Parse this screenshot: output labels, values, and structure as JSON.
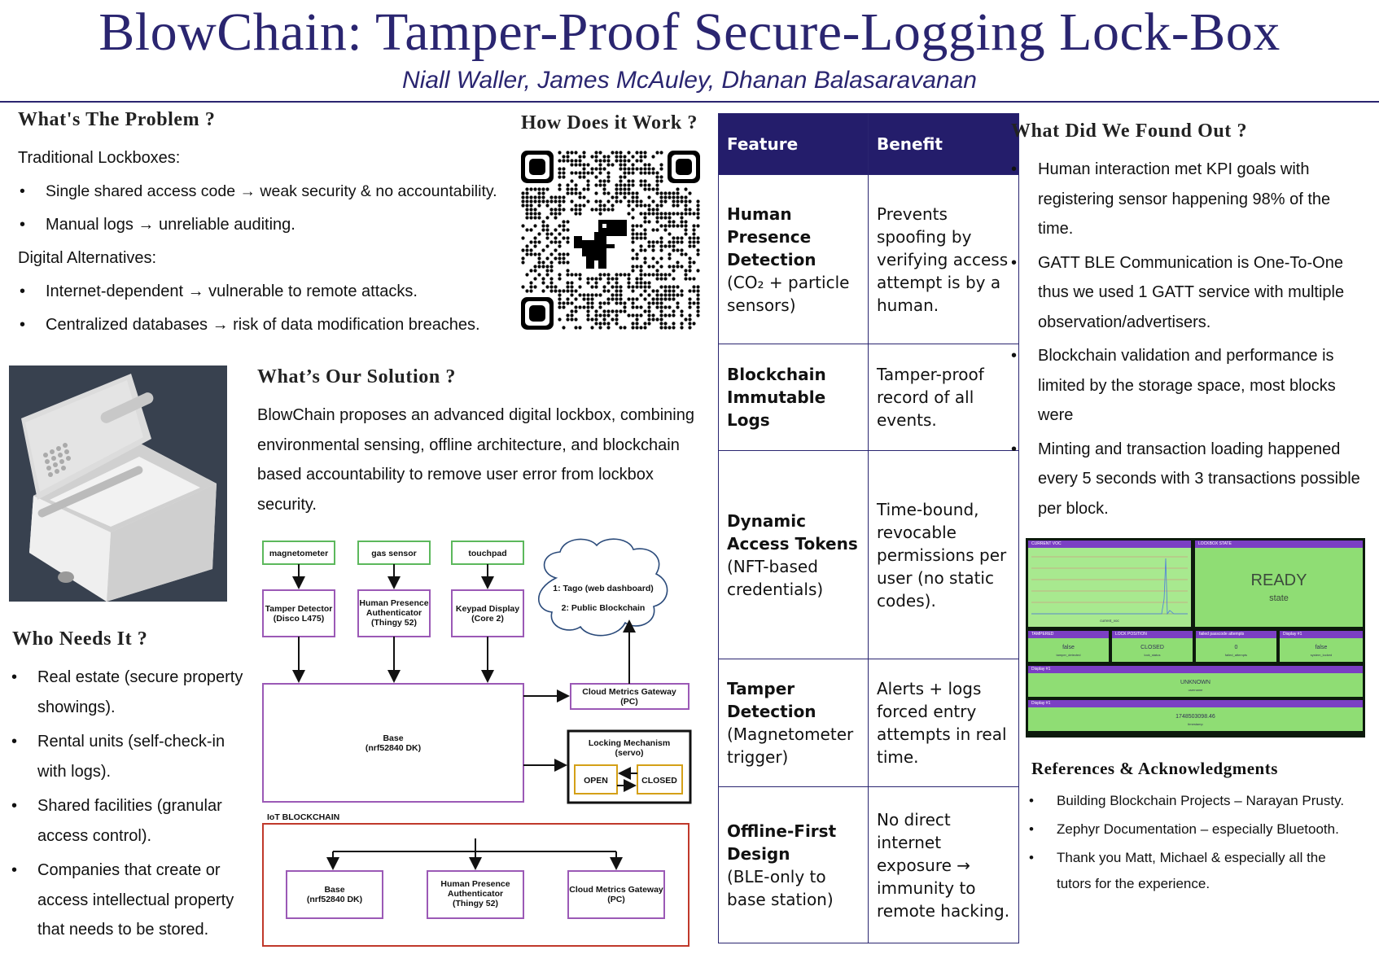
{
  "header": {
    "title": "BlowChain: Tamper-Proof Secure-Logging Lock-Box",
    "authors": "Niall Waller, James McAuley, Dhanan Balasaravanan"
  },
  "problem": {
    "heading": "What's The Problem ?",
    "traditional_label": "Traditional Lockboxes:",
    "traditional_items": [
      "Single shared access code → weak security & no accountability.",
      "Manual logs → unreliable auditing."
    ],
    "digital_label": "Digital Alternatives:",
    "digital_items": [
      "Internet-dependent → vulnerable to remote attacks.",
      "Centralized databases → risk of data modification breaches."
    ]
  },
  "how": {
    "heading": "How Does it Work ?"
  },
  "solution": {
    "heading": "What’s Our Solution ?",
    "text": "BlowChain proposes an advanced digital lockbox, combining environmental sensing, offline architecture, and blockchain based accountability to remove user error from lockbox security."
  },
  "who": {
    "heading": "Who Needs It ?",
    "items": [
      "Real estate (secure property showings).",
      "Rental units (self-check-in with logs).",
      "Shared facilities (granular access control).",
      "Companies that create or access intellectual property that needs to be stored."
    ]
  },
  "diagram": {
    "sensors": [
      "magnetometer",
      "gas sensor",
      "touchpad"
    ],
    "mcus": [
      {
        "l1": "Tamper Detector",
        "l2": "(Disco L475)"
      },
      {
        "l1": "Human Presence",
        "l2": "Authenticator",
        "l3": "(Thingy 52)"
      },
      {
        "l1": "Keypad Display",
        "l2": "(Core 2)"
      }
    ],
    "cloud": [
      "1: Tago (web dashboard)",
      "2: Public Blockchain"
    ],
    "gateway": {
      "l1": "Cloud Metrics Gateway",
      "l2": "(PC)"
    },
    "base": {
      "l1": "Base",
      "l2": "(nrf52840 DK)"
    },
    "lock": {
      "l1": "Locking Mechanism",
      "l2": "(servo)",
      "open": "OPEN",
      "closed": "CLOSED"
    },
    "iot_label": "IoT BLOCKCHAIN",
    "iot_nodes": [
      {
        "l1": "Base",
        "l2": "(nrf52840 DK)"
      },
      {
        "l1": "Human Presence",
        "l2": "Authenticator",
        "l3": "(Thingy 52)"
      },
      {
        "l1": "Cloud Metrics Gateway",
        "l2": "(PC)"
      }
    ]
  },
  "table": {
    "col_feature": "Feature",
    "col_benefit": "Benefit",
    "rows": [
      {
        "title": "Human Presence Detection",
        "sub": "(CO₂ + particle sensors)",
        "benefit": "Prevents spoofing by verifying access attempt is by a human."
      },
      {
        "title": "Blockchain Immutable Logs",
        "sub": "",
        "benefit": "Tamper-proof record of all events."
      },
      {
        "title": "Dynamic Access Tokens",
        "sub": "(NFT-based credentials)",
        "benefit": "Time-bound, revocable permissions per user (no static codes)."
      },
      {
        "title": "Tamper Detection",
        "sub": "(Magnetometer trigger)",
        "benefit": "Alerts + logs forced entry attempts in real time."
      },
      {
        "title": "Offline-First Design",
        "sub": "(BLE-only to base station)",
        "benefit": "No direct internet exposure → immunity to remote hacking."
      }
    ]
  },
  "found": {
    "heading": "What Did We Found Out ?",
    "items": [
      "Human interaction met KPI goals with registering sensor happening 98% of the time.",
      "GATT BLE Communication is One-To-One thus we used 1 GATT service with multiple observation/advertisers.",
      "Blockchain validation and performance is limited by the storage space, most blocks were",
      "Minting and transaction loading happened every 5 seconds with 3 transactions possible per block."
    ]
  },
  "dashboard": {
    "voc_label": "CURRENT VOC",
    "state_label": "LOCKBOX STATE",
    "state_value": "READY",
    "state_sub": "state",
    "legend": "current_voc",
    "tiles": [
      {
        "head": "TAMPERED",
        "value": "false",
        "sub": "tamper_detected"
      },
      {
        "head": "LOCK POSITION",
        "value": "CLOSED",
        "sub": "lock_status"
      },
      {
        "head": "failed passcode attempts",
        "value": "0",
        "sub": "failed_attempts"
      },
      {
        "head": "Display #1",
        "value": "false",
        "sub": "system_locked"
      }
    ],
    "row1_head": "Display #1",
    "row1_value": "UNKNOWN",
    "row1_sub": "username",
    "row2_head": "Display #1",
    "row2_value": "1748503098.46",
    "row2_sub": "timestamp",
    "colors": {
      "panel": "#8fdd74",
      "header": "#7b3fc4",
      "background": "#0d1a0d"
    }
  },
  "refs": {
    "heading": "References & Acknowledgments",
    "items": [
      "Building Blockchain Projects – Narayan Prusty.",
      "Zephyr Documentation – especially Bluetooth.",
      "Thank you Matt, Michael & especially all the tutors for the experience."
    ]
  },
  "colors": {
    "accent": "#2a2570",
    "table_header": "#241d6b",
    "iot_border": "#c0392b",
    "lock_border": "#d4a017",
    "sensor_border": "#5cb85c",
    "mcu_border": "#9b59b6"
  }
}
